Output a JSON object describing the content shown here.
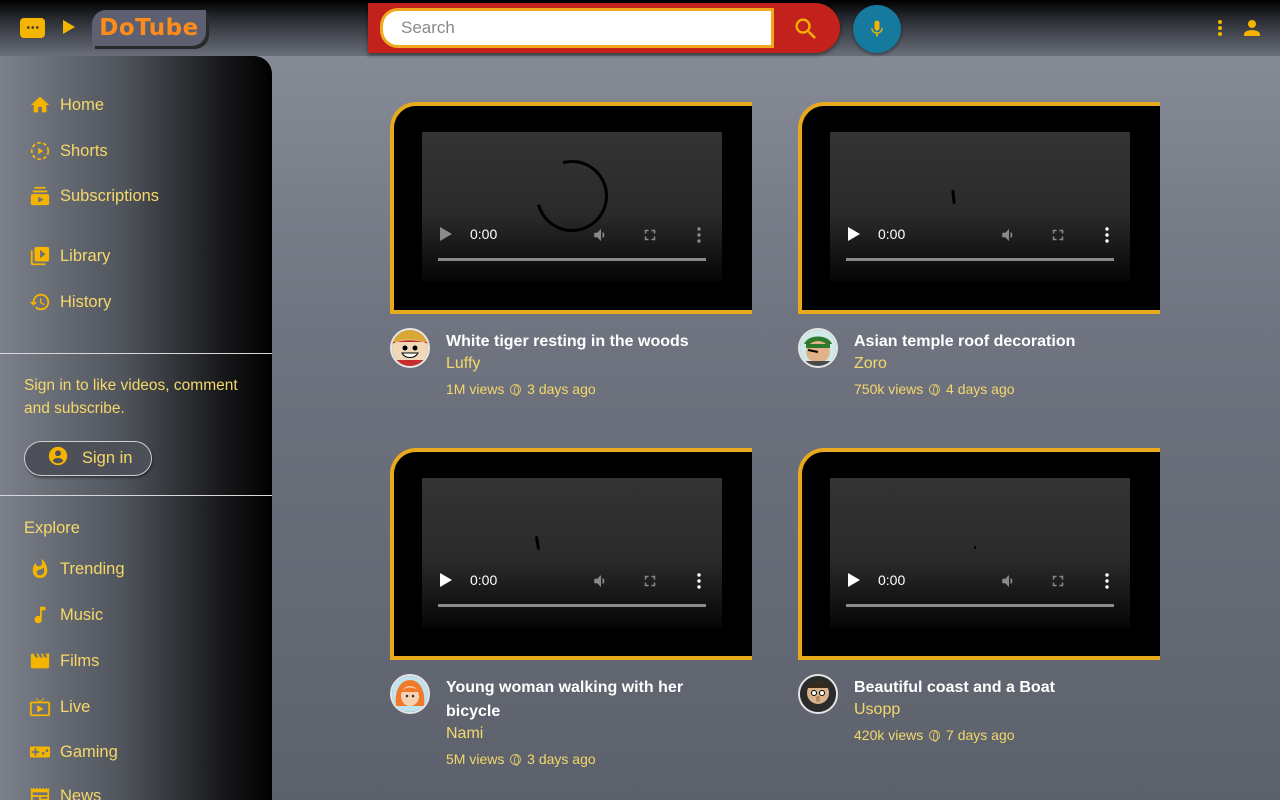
{
  "app": {
    "logo": "DoTube"
  },
  "search": {
    "placeholder": "Search"
  },
  "sidebar": {
    "primary": [
      {
        "label": "Home",
        "icon": "home-icon"
      },
      {
        "label": "Shorts",
        "icon": "shorts-icon"
      },
      {
        "label": "Subscriptions",
        "icon": "subscriptions-icon"
      }
    ],
    "secondary": [
      {
        "label": "Library",
        "icon": "library-icon"
      },
      {
        "label": "History",
        "icon": "history-icon"
      }
    ],
    "signin_prompt": "Sign in to like videos, comment and subscribe.",
    "signin_label": "Sign in",
    "explore_title": "Explore",
    "explore": [
      {
        "label": "Trending",
        "icon": "flame-icon"
      },
      {
        "label": "Music",
        "icon": "music-note-icon"
      },
      {
        "label": "Films",
        "icon": "film-icon"
      },
      {
        "label": "Live",
        "icon": "live-icon"
      },
      {
        "label": "Gaming",
        "icon": "gamepad-icon"
      },
      {
        "label": "News",
        "icon": "news-icon"
      }
    ]
  },
  "videos": [
    {
      "title": "White tiger resting in the woods",
      "channel": "Luffy",
      "views": "1M views",
      "age": "3 days ago",
      "time": "0:00"
    },
    {
      "title": "Asian temple roof decoration",
      "channel": "Zoro",
      "views": "750k views",
      "age": "4 days ago",
      "time": "0:00"
    },
    {
      "title": "Young woman walking with her bicycle",
      "channel": "Nami",
      "views": "5M views",
      "age": "3 days ago",
      "time": "0:00"
    },
    {
      "title": "Beautiful coast and a Boat",
      "channel": "Usopp",
      "views": "420k views",
      "age": "7 days ago",
      "time": "0:00"
    }
  ],
  "colors": {
    "accent": "#f5d869",
    "border": "#e8a91c",
    "search_bg": "#c3211b",
    "mic_bg": "#157a9e",
    "logo": "#ff8c1a"
  }
}
